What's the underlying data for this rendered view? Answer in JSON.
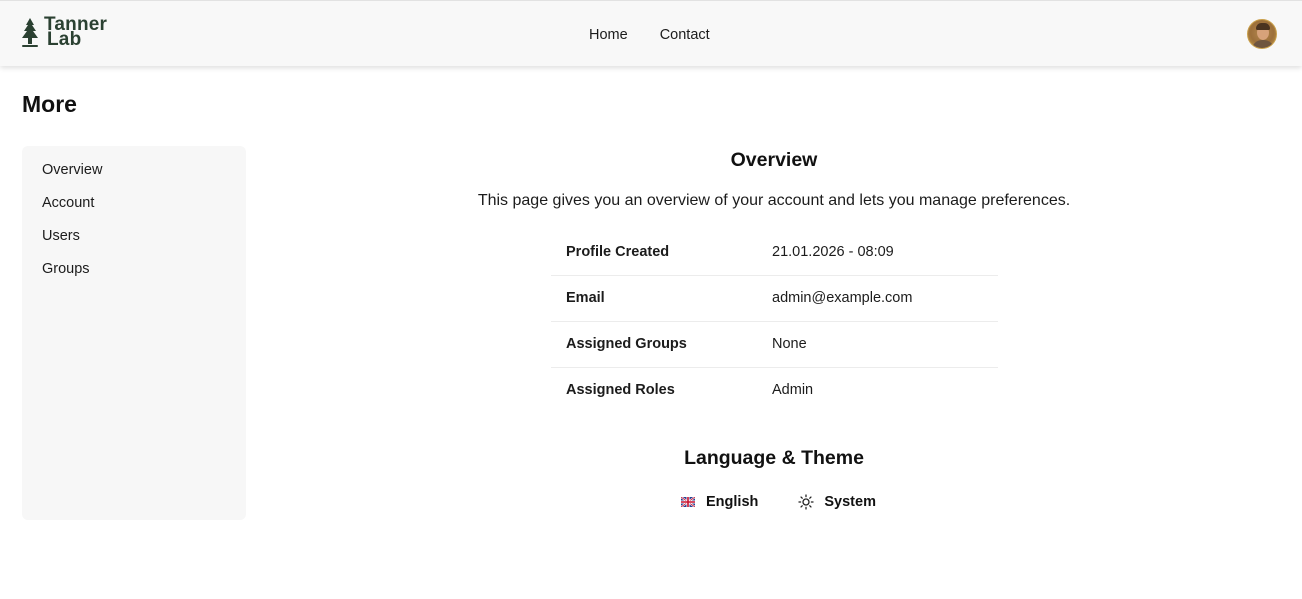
{
  "brand": {
    "line1": "Tanner",
    "line2": "Lab",
    "color": "#2b4132"
  },
  "nav": {
    "home": "Home",
    "contact": "Contact"
  },
  "page": {
    "title": "More"
  },
  "sidebar": {
    "items": [
      {
        "label": "Overview"
      },
      {
        "label": "Account"
      },
      {
        "label": "Users"
      },
      {
        "label": "Groups"
      }
    ]
  },
  "overview": {
    "title": "Overview",
    "description": "This page gives you an overview of your account and lets you manage preferences.",
    "rows": [
      {
        "key": "Profile Created",
        "value": "21.01.2026 - 08:09"
      },
      {
        "key": "Email",
        "value": "admin@example.com"
      },
      {
        "key": "Assigned Groups",
        "value": "None"
      },
      {
        "key": "Assigned Roles",
        "value": "Admin"
      }
    ]
  },
  "preferences": {
    "title": "Language & Theme",
    "language": {
      "label": "English",
      "icon": "uk-flag-icon"
    },
    "theme": {
      "label": "System",
      "icon": "sun-icon"
    }
  }
}
